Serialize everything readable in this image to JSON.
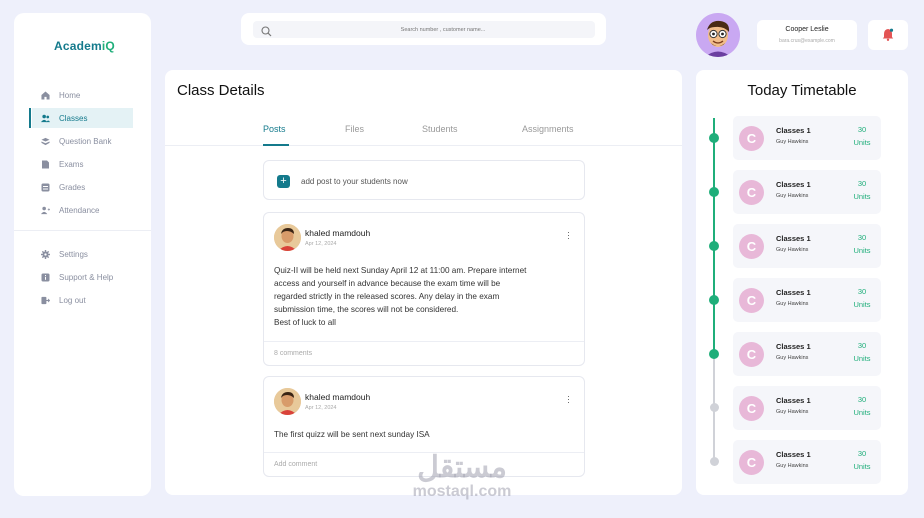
{
  "app": {
    "logo_prefix": "Academ",
    "logo_suffix": "iQ"
  },
  "sidebar": {
    "items": [
      {
        "label": "Home",
        "icon": "home-icon"
      },
      {
        "label": "Classes",
        "icon": "users-icon",
        "active": true
      },
      {
        "label": "Question Bank",
        "icon": "stack-icon"
      },
      {
        "label": "Exams",
        "icon": "document-icon"
      },
      {
        "label": "Grades",
        "icon": "table-icon"
      },
      {
        "label": "Attendance",
        "icon": "user-add-icon"
      }
    ],
    "bottom_items": [
      {
        "label": "Settings",
        "icon": "gear-icon"
      },
      {
        "label": "Support & Help",
        "icon": "info-icon"
      },
      {
        "label": "Log out",
        "icon": "logout-icon"
      }
    ]
  },
  "search": {
    "placeholder": "Search number , customer name..."
  },
  "user": {
    "name": "Cooper Leslie",
    "email": "bara.crus@example.com"
  },
  "main": {
    "title": "Class Details",
    "tabs": [
      {
        "label": "Posts",
        "active": true
      },
      {
        "label": "Files"
      },
      {
        "label": "Students"
      },
      {
        "label": "Assignments"
      }
    ],
    "add_post_label": "add post to your students now",
    "posts": [
      {
        "author": "khaled mamdouh",
        "date": "Apr 12, 2024",
        "lines": [
          "Quiz-II will be held next Sunday April 12 at 11:00 am. Prepare internet",
          "access and yourself in advance because the exam time will be",
          "regarded strictly in the released scores. Any delay in the exam",
          "submission time, the scores will not be considered.",
          "Best of luck to all"
        ],
        "footer": "8 comments"
      },
      {
        "author": "khaled mamdouh",
        "date": "Apr 12, 2024",
        "lines": [
          "The first quizz will be sent next sunday ISA"
        ],
        "footer": "Add comment"
      }
    ]
  },
  "watermark": {
    "arabic": "مستقل",
    "latin": "mostaql.com"
  },
  "timetable": {
    "title": "Today Timetable",
    "entries": [
      {
        "initial": "C",
        "name": "Classes 1",
        "teacher": "Guy Hawkins",
        "count": "30",
        "unit": "Units",
        "done": true
      },
      {
        "initial": "C",
        "name": "Classes 1",
        "teacher": "Guy Hawkins",
        "count": "30",
        "unit": "Units",
        "done": true
      },
      {
        "initial": "C",
        "name": "Classes 1",
        "teacher": "Guy Hawkins",
        "count": "30",
        "unit": "Units",
        "done": true
      },
      {
        "initial": "C",
        "name": "Classes 1",
        "teacher": "Guy Hawkins",
        "count": "30",
        "unit": "Units",
        "done": true
      },
      {
        "initial": "C",
        "name": "Classes 1",
        "teacher": "Guy Hawkins",
        "count": "30",
        "unit": "Units",
        "done": true
      },
      {
        "initial": "C",
        "name": "Classes 1",
        "teacher": "Guy Hawkins",
        "count": "30",
        "unit": "Units",
        "done": false
      },
      {
        "initial": "C",
        "name": "Classes 1",
        "teacher": "Guy Hawkins",
        "count": "30",
        "unit": "Units",
        "done": false
      }
    ]
  },
  "colors": {
    "accent": "#147a8c",
    "green": "#1fae7a",
    "pending": "#d0d2d8",
    "avatar_pink": "#e8b8d8"
  }
}
